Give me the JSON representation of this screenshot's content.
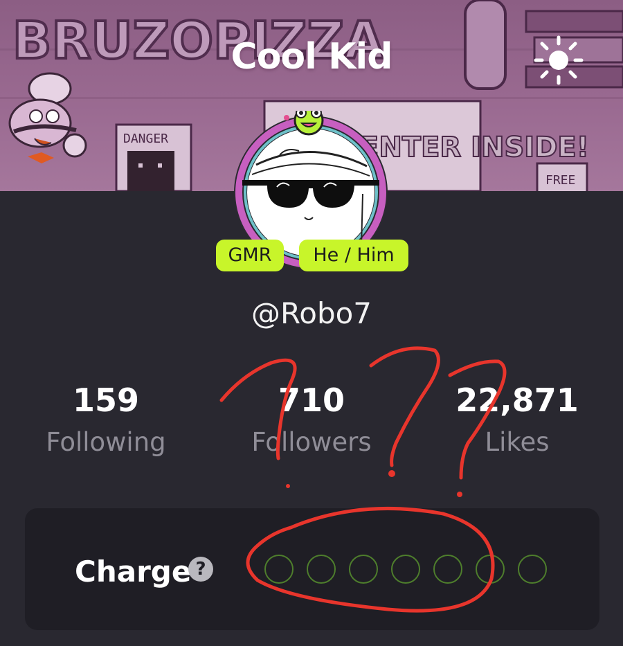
{
  "header": {
    "title": "Cool Kid",
    "theme_icon": "sun-icon"
  },
  "banner": {
    "wordmark": "BRUZOPIZZA",
    "signs": [
      "DANGER",
      "ENTER INSIDE!",
      "FREE"
    ]
  },
  "profile": {
    "tags": [
      "GMR",
      "He / Him"
    ],
    "handle": "@Robo7"
  },
  "stats": [
    {
      "value": "159",
      "label": "Following"
    },
    {
      "value": "710",
      "label": "Followers"
    },
    {
      "value": "22,871",
      "label": "Likes"
    }
  ],
  "charge": {
    "label": "Charge",
    "help_icon": "?",
    "filled": 0,
    "total": 7
  },
  "colors": {
    "background": "#292830",
    "card": "#1f1e25",
    "accent": "#c8f52a",
    "annotation": "#e8352c"
  }
}
